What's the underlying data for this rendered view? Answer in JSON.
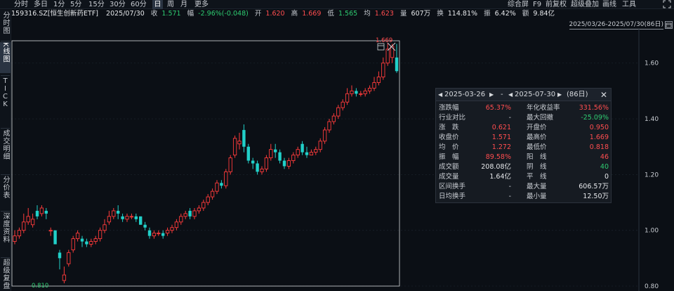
{
  "toolbar": {
    "periods": [
      "分时",
      "多日",
      "1分",
      "5分",
      "15分",
      "30分",
      "60分",
      "日",
      "周",
      "月",
      "更多"
    ],
    "active_period": "日",
    "right_items": [
      "综合屏",
      "F9",
      "前复权",
      "超级叠加",
      "画线",
      "工具"
    ],
    "right_icon": "expand-icon"
  },
  "sidebar": {
    "items": [
      "分时图",
      "K线图",
      "TICK",
      "成交明细",
      "分价表",
      "深度资料",
      "超级复盘"
    ],
    "active": "K线图"
  },
  "info": {
    "code_name": "159316.SZ[恒生创新药ETF]",
    "date": "2025/07/30",
    "close_label": "收",
    "close": "1.571",
    "change_label": "幅",
    "change": "-2.96%(-0.048)",
    "open_label": "开",
    "open": "1.620",
    "high_label": "高",
    "high": "1.669",
    "low_label": "低",
    "low": "1.565",
    "avg_label": "均",
    "avg": "1.623",
    "vol_label": "量",
    "vol": "607万",
    "turn_label": "换",
    "turn": "114.81%",
    "amp_label": "振",
    "amp": "6.42%",
    "amt_label": "额",
    "amt": "9.84亿"
  },
  "date_range": "2025/03/26-2025/07/30(86日)",
  "chart_data": {
    "type": "candlestick",
    "ylim": [
      0.8,
      1.68
    ],
    "yticks": [
      "1.60",
      "1.40",
      "1.20",
      "1.00",
      "0.80"
    ],
    "ytick_values": [
      1.6,
      1.4,
      1.2,
      1.0,
      0.8
    ],
    "max_label": "1.669",
    "min_label": "0.810",
    "up_color": "#ff3b3b",
    "down_color": "#21d0c9",
    "candles": [
      [
        0.96,
        0.98,
        1.0,
        0.95
      ],
      [
        0.98,
        1.0,
        1.01,
        0.97
      ],
      [
        1.0,
        1.03,
        1.06,
        0.99
      ],
      [
        1.03,
        1.05,
        1.08,
        1.02
      ],
      [
        1.02,
        1.04,
        1.06,
        1.01
      ],
      [
        1.07,
        1.05,
        1.09,
        1.04
      ],
      [
        1.06,
        1.08,
        1.09,
        1.05
      ],
      [
        1.07,
        1.06,
        1.08,
        1.04
      ],
      [
        1.0,
        1.0,
        1.01,
        0.98
      ],
      [
        1.0,
        0.95,
        1.0,
        0.95
      ],
      [
        0.92,
        0.9,
        0.93,
        0.86
      ],
      [
        0.82,
        0.84,
        0.87,
        0.81
      ],
      [
        0.88,
        0.92,
        0.93,
        0.87
      ],
      [
        0.93,
        0.97,
        0.98,
        0.92
      ],
      [
        0.97,
        0.99,
        1.0,
        0.96
      ],
      [
        0.97,
        0.96,
        0.98,
        0.94
      ],
      [
        0.96,
        0.95,
        0.97,
        0.94
      ],
      [
        0.95,
        0.96,
        0.97,
        0.94
      ],
      [
        0.96,
        0.97,
        0.98,
        0.95
      ],
      [
        0.97,
        1.0,
        1.01,
        0.96
      ],
      [
        1.0,
        1.02,
        1.04,
        0.99
      ],
      [
        1.03,
        1.05,
        1.07,
        1.02
      ],
      [
        1.05,
        1.07,
        1.08,
        1.04
      ],
      [
        1.07,
        1.06,
        1.09,
        1.04
      ],
      [
        1.05,
        1.04,
        1.06,
        1.03
      ],
      [
        1.04,
        1.05,
        1.06,
        1.03
      ],
      [
        1.05,
        1.05,
        1.06,
        1.04
      ],
      [
        1.05,
        1.04,
        1.06,
        1.03
      ],
      [
        1.05,
        1.02,
        1.05,
        1.02
      ],
      [
        1.02,
        1.01,
        1.03,
        1.0
      ],
      [
        1.0,
        0.98,
        1.01,
        0.97
      ],
      [
        0.98,
        0.99,
        1.0,
        0.97
      ],
      [
        0.99,
        0.99,
        1.0,
        0.98
      ],
      [
        0.99,
        0.98,
        1.0,
        0.97
      ],
      [
        0.99,
        1.0,
        1.01,
        0.98
      ],
      [
        1.0,
        1.01,
        1.02,
        0.99
      ],
      [
        1.01,
        1.03,
        1.04,
        1.0
      ],
      [
        1.03,
        1.05,
        1.06,
        1.02
      ],
      [
        1.05,
        1.06,
        1.07,
        1.04
      ],
      [
        1.07,
        1.05,
        1.08,
        1.04
      ],
      [
        1.05,
        1.07,
        1.08,
        1.04
      ],
      [
        1.07,
        1.08,
        1.09,
        1.06
      ],
      [
        1.08,
        1.1,
        1.11,
        1.07
      ],
      [
        1.1,
        1.12,
        1.13,
        1.09
      ],
      [
        1.12,
        1.14,
        1.15,
        1.11
      ],
      [
        1.14,
        1.17,
        1.18,
        1.13
      ],
      [
        1.17,
        1.16,
        1.18,
        1.15
      ],
      [
        1.16,
        1.21,
        1.22,
        1.15
      ],
      [
        1.21,
        1.26,
        1.27,
        1.2
      ],
      [
        1.27,
        1.33,
        1.34,
        1.26
      ],
      [
        1.31,
        1.32,
        1.35,
        1.29
      ],
      [
        1.36,
        1.3,
        1.38,
        1.28
      ],
      [
        1.3,
        1.25,
        1.31,
        1.24
      ],
      [
        1.25,
        1.24,
        1.26,
        1.22
      ],
      [
        1.24,
        1.21,
        1.25,
        1.2
      ],
      [
        1.21,
        1.22,
        1.23,
        1.2
      ],
      [
        1.22,
        1.26,
        1.27,
        1.21
      ],
      [
        1.26,
        1.29,
        1.31,
        1.25
      ],
      [
        1.29,
        1.28,
        1.31,
        1.26
      ],
      [
        1.28,
        1.25,
        1.29,
        1.24
      ],
      [
        1.25,
        1.23,
        1.26,
        1.22
      ],
      [
        1.23,
        1.25,
        1.26,
        1.22
      ],
      [
        1.25,
        1.27,
        1.28,
        1.24
      ],
      [
        1.27,
        1.29,
        1.3,
        1.26
      ],
      [
        1.31,
        1.28,
        1.32,
        1.27
      ],
      [
        1.28,
        1.27,
        1.3,
        1.26
      ],
      [
        1.27,
        1.28,
        1.29,
        1.27
      ],
      [
        1.28,
        1.29,
        1.3,
        1.27
      ],
      [
        1.29,
        1.32,
        1.33,
        1.28
      ],
      [
        1.32,
        1.36,
        1.37,
        1.31
      ],
      [
        1.36,
        1.39,
        1.4,
        1.35
      ],
      [
        1.39,
        1.41,
        1.42,
        1.38
      ],
      [
        1.41,
        1.44,
        1.45,
        1.4
      ],
      [
        1.44,
        1.46,
        1.47,
        1.43
      ],
      [
        1.46,
        1.49,
        1.51,
        1.45
      ],
      [
        1.49,
        1.5,
        1.52,
        1.48
      ],
      [
        1.5,
        1.49,
        1.51,
        1.48
      ],
      [
        1.49,
        1.49,
        1.5,
        1.48
      ],
      [
        1.49,
        1.5,
        1.51,
        1.48
      ],
      [
        1.5,
        1.51,
        1.52,
        1.49
      ],
      [
        1.51,
        1.53,
        1.55,
        1.5
      ],
      [
        1.53,
        1.55,
        1.57,
        1.52
      ],
      [
        1.55,
        1.6,
        1.62,
        1.54
      ],
      [
        1.6,
        1.65,
        1.67,
        1.59
      ],
      [
        1.62,
        1.66,
        1.669,
        1.6
      ],
      [
        1.62,
        1.571,
        1.669,
        1.565
      ]
    ]
  },
  "popup": {
    "start_date": "2025-03-26",
    "end_date": "2025-07-30",
    "days": "(86日)",
    "rows": [
      {
        "l1": "涨跌幅",
        "v1": "65.37%",
        "c1": "up",
        "l2": "年化收益率",
        "v2": "331.56%",
        "c2": "up"
      },
      {
        "l1": "行业对比",
        "v1": "-",
        "c1": "grey",
        "l2": "最大回撤",
        "v2": "-25.09%",
        "c2": "down"
      },
      {
        "l1": "涨　跌",
        "v1": "0.621",
        "c1": "up",
        "l2": "开盘价",
        "v2": "0.950",
        "c2": "up"
      },
      {
        "l1": "收盘价",
        "v1": "1.571",
        "c1": "up",
        "l2": "最高价",
        "v2": "1.669",
        "c2": "up"
      },
      {
        "l1": "均　价",
        "v1": "1.272",
        "c1": "up",
        "l2": "最低价",
        "v2": "0.818",
        "c2": "up"
      },
      {
        "l1": "振　幅",
        "v1": "89.58%",
        "c1": "up",
        "l2": "阳　线",
        "v2": "46",
        "c2": "up"
      },
      {
        "l1": "成交额",
        "v1": "208.08亿",
        "c1": "wh",
        "l2": "阴　线",
        "v2": "40",
        "c2": "down"
      },
      {
        "l1": "成交量",
        "v1": "1.64亿",
        "c1": "wh",
        "l2": "平　线",
        "v2": "0",
        "c2": "wh"
      },
      {
        "l1": "区间换手",
        "v1": "-",
        "c1": "grey",
        "l2": "最大量",
        "v2": "606.57万",
        "c2": "wh"
      },
      {
        "l1": "日均换手",
        "v1": "-",
        "c1": "grey",
        "l2": "最小量",
        "v2": "12.50万",
        "c2": "wh"
      }
    ]
  }
}
